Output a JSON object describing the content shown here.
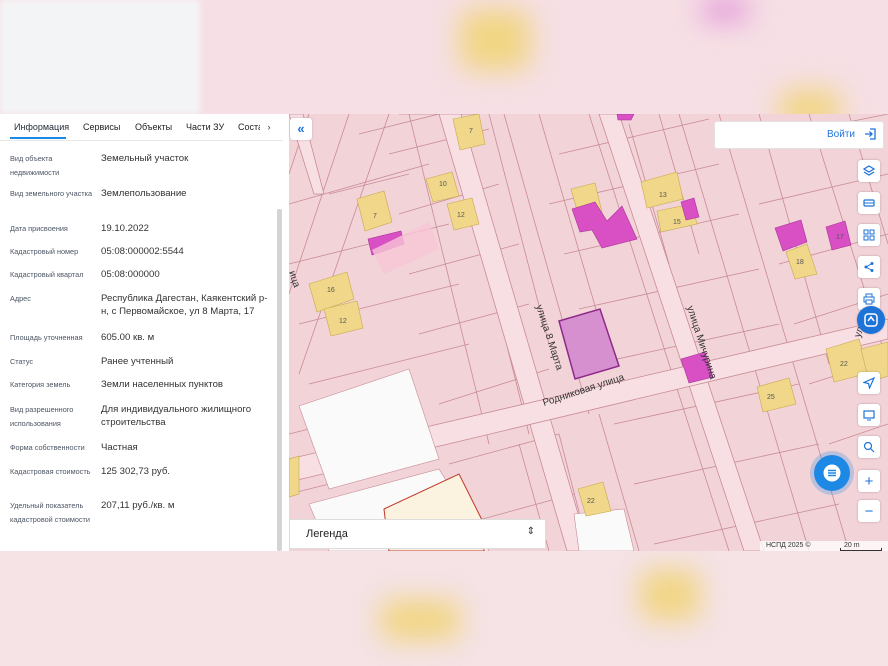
{
  "panel": {
    "tabs": [
      {
        "label": "Информация",
        "active": true
      },
      {
        "label": "Сервисы"
      },
      {
        "label": "Объекты"
      },
      {
        "label": "Части ЗУ"
      },
      {
        "label": "Соста"
      }
    ],
    "rows": [
      {
        "label": "Вид объекта недвижимости",
        "value": "Земельный участок"
      },
      {
        "label": "Вид земельного участка",
        "value": "Землепользование"
      },
      {
        "label": "Дата присвоения",
        "value": "19.10.2022"
      },
      {
        "label": "Кадастровый номер",
        "value": "05:08:000002:5544"
      },
      {
        "label": "Кадастровый квартал",
        "value": "05:08:000000"
      },
      {
        "label": "Адрес",
        "value": "Республика Дагестан, Каякентский р-н, с Первомайское, ул 8 Марта, 17"
      },
      {
        "label": "Площадь уточненная",
        "value": "605.00 кв. м"
      },
      {
        "label": "Статус",
        "value": "Ранее учтенный"
      },
      {
        "label": "Категория земель",
        "value": "Земли населенных пунктов"
      },
      {
        "label": "Вид разрешенного использования",
        "value": "Для индивидуального жилищного строительства"
      },
      {
        "label": "Форма собственности",
        "value": "Частная"
      },
      {
        "label": "Кадастровая стоимость",
        "value": "125 302,73 руб."
      },
      {
        "label": "Удельный показатель кадастровой стоимости",
        "value": "207,11 руб./кв. м"
      }
    ]
  },
  "map": {
    "login_label": "Войти",
    "legend_label": "Легенда",
    "copyright": "НСПД 2025 ©",
    "scale": "20 m",
    "streets": [
      "улица 8 Марта",
      "Родниковая улица",
      "улица Мичурина",
      "улица Ос",
      "ица"
    ],
    "parcel_numbers": [
      "7",
      "10",
      "12",
      "7",
      "16",
      "12",
      "13",
      "15",
      "17",
      "18",
      "22",
      "25",
      "22"
    ],
    "colors": {
      "map_bg": "#f2d3d8",
      "parcel_line": "#c98b95",
      "building": "#f0d78a",
      "magenta": "#d94fc4",
      "selected": "#d68fcf",
      "accent": "#1e73d8"
    }
  }
}
